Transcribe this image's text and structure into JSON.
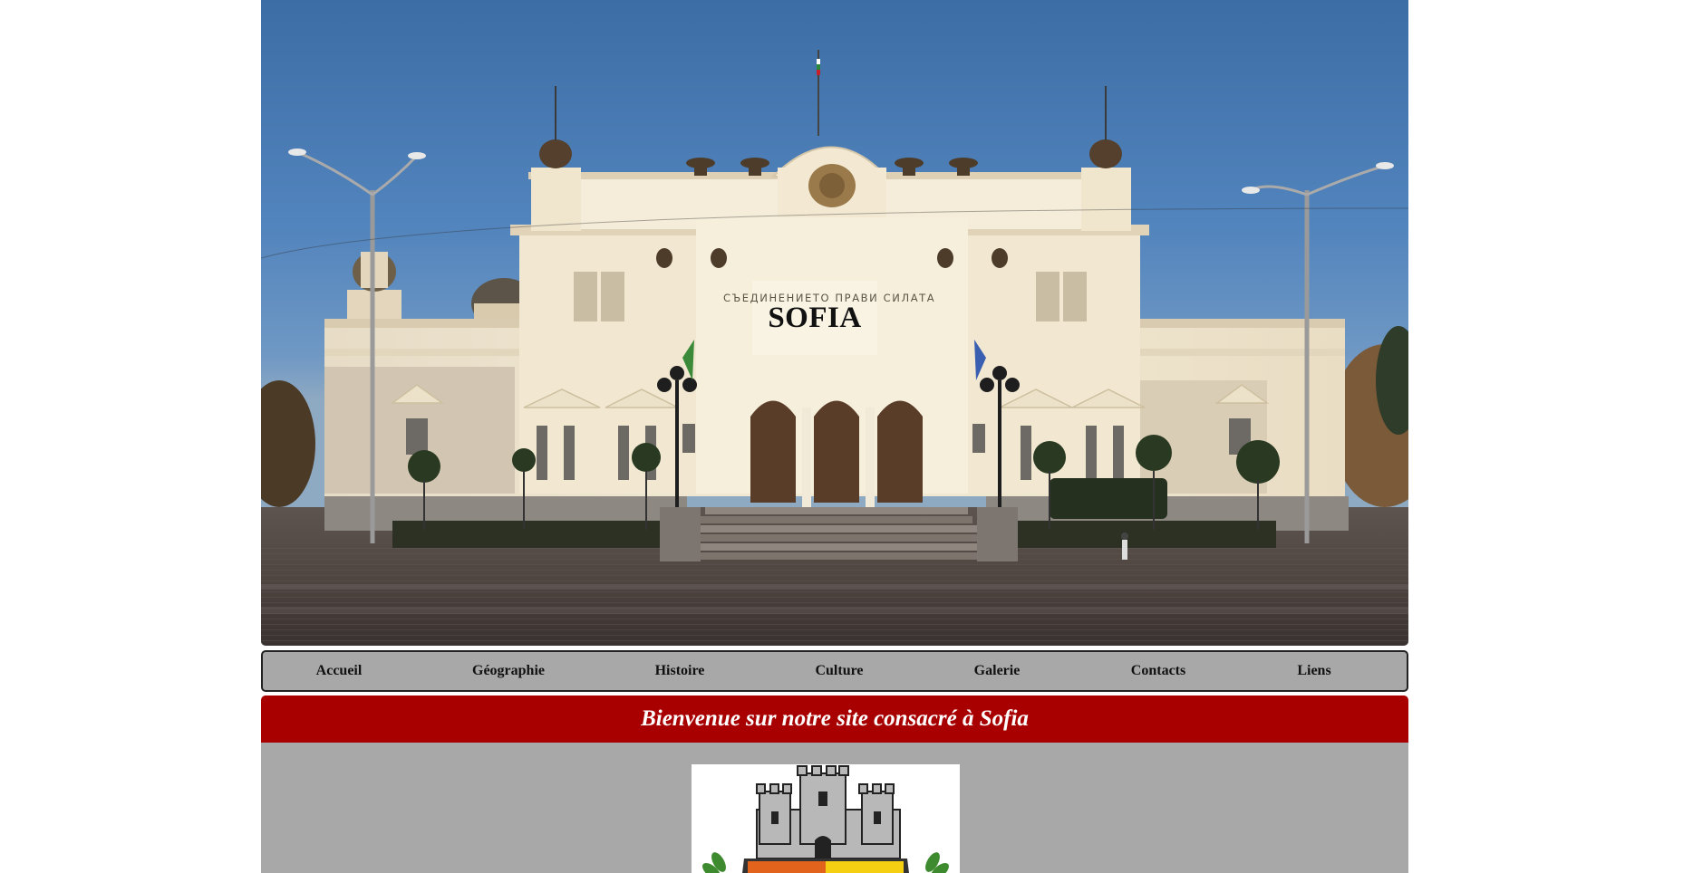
{
  "hero": {
    "motto": "СЪЕДИНЕНИЕТО ПРАВИ СИЛАТА",
    "title": "SOFIA"
  },
  "nav": {
    "items": [
      {
        "label": "Accueil"
      },
      {
        "label": "Géographie"
      },
      {
        "label": "Histoire"
      },
      {
        "label": "Culture"
      },
      {
        "label": "Galerie"
      },
      {
        "label": "Contacts"
      },
      {
        "label": "Liens"
      }
    ]
  },
  "welcome": {
    "text": "Bienvenue sur notre site consacré à Sofia"
  },
  "colors": {
    "welcome_bg": "#a80000",
    "nav_bg": "#a8a8a8",
    "content_bg": "#a8a8a8"
  }
}
